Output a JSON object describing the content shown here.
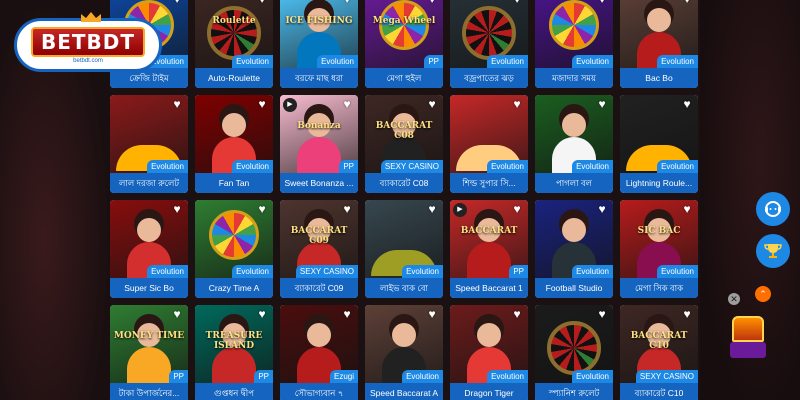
{
  "logo": {
    "text": "BETBDT",
    "sub": "betbdt.com"
  },
  "colors": {
    "accent": "#1565c0",
    "tag": "#1e88e5",
    "background": "#1b1112"
  },
  "games": [
    {
      "name": "ক্রেজি টাইম",
      "provider": "Evolution",
      "art": "wheel",
      "bg": "#0d47a1",
      "body": "#c2185b"
    },
    {
      "name": "Auto-Roulette",
      "provider": "Evolution",
      "art": "roulette",
      "bg": "#3e2723",
      "label": "Roulette"
    },
    {
      "name": "বরফে মাছ ধরা",
      "provider": "Evolution",
      "art": "person",
      "bg": "#4fc3f7",
      "body": "#0277bd",
      "label": "ICE FISHING"
    },
    {
      "name": "মেগা হুইল",
      "provider": "PP",
      "art": "wheel",
      "bg": "#6a1b9a",
      "label": "Mega Wheel"
    },
    {
      "name": "বজ্রপাতের ঝড়",
      "provider": "Evolution",
      "art": "roulette",
      "bg": "#263238"
    },
    {
      "name": "মজাদার সময়",
      "provider": "Evolution",
      "art": "wheel",
      "bg": "#4a148c"
    },
    {
      "name": "Bac Bo",
      "provider": "Evolution",
      "art": "person",
      "bg": "#5d4037",
      "body": "#b71c1c"
    },
    {
      "name": "লাল দরজা রুলেট",
      "provider": "Evolution",
      "art": "table",
      "bg": "#8b1a1a",
      "body": "#ffb300"
    },
    {
      "name": "Fan Tan",
      "provider": "Evolution",
      "art": "person",
      "bg": "#7f0000",
      "body": "#e53935"
    },
    {
      "name": "Sweet Bonanza ...",
      "provider": "PP",
      "art": "person",
      "bg": "#f8bbd0",
      "body": "#ec407a",
      "label": "Bonanza",
      "play": true
    },
    {
      "name": "ব্যাকারেট C08",
      "provider": "SEXY CASINO",
      "art": "person",
      "bg": "#3e2723",
      "body": "#212121",
      "label": "BACCARAT C08"
    },
    {
      "name": "শিল্ড সুপার সি...",
      "provider": "Evolution",
      "art": "table",
      "bg": "#c62828",
      "body": "#ffcc80"
    },
    {
      "name": "পাগলা বল",
      "provider": "Evolution",
      "art": "person",
      "bg": "#1b5e20",
      "body": "#f5f5f5"
    },
    {
      "name": "Lightning Roule...",
      "provider": "Evolution",
      "art": "table",
      "bg": "#212121",
      "body": "#ffb300"
    },
    {
      "name": "Super Sic Bo",
      "provider": "Evolution",
      "art": "person",
      "bg": "#880e0e",
      "body": "#d32f2f"
    },
    {
      "name": "Crazy Time A",
      "provider": "Evolution",
      "art": "wheel",
      "bg": "#2e7d32"
    },
    {
      "name": "ব্যাকারেট C09",
      "provider": "SEXY CASINO",
      "art": "person",
      "bg": "#4e342e",
      "body": "#c62828",
      "label": "BACCARAT C09"
    },
    {
      "name": "লাইভ বাক বো",
      "provider": "Evolution",
      "art": "table",
      "bg": "#37474f",
      "body": "#9e9d24"
    },
    {
      "name": "Speed Baccarat 1",
      "provider": "PP",
      "art": "person",
      "bg": "#c62828",
      "body": "#b71c1c",
      "label": "BACCARAT",
      "play": true
    },
    {
      "name": "Football Studio",
      "provider": "Evolution",
      "art": "person",
      "bg": "#1a237e",
      "body": "#263238"
    },
    {
      "name": "মেগা সিক বাক",
      "provider": "Evolution",
      "art": "person",
      "bg": "#b71c1c",
      "body": "#880e4f",
      "label": "SIC BAC"
    },
    {
      "name": "টাকা উপার্জনের...",
      "provider": "PP",
      "art": "person",
      "bg": "#2e7d32",
      "body": "#f9a825",
      "label": "MONEY TIME"
    },
    {
      "name": "গুপ্তধন দ্বীপ",
      "provider": "PP",
      "art": "person",
      "bg": "#00695c",
      "body": "#c62828",
      "label": "TREASURE ISLAND"
    },
    {
      "name": "সৌভাগ্যবান ৭",
      "provider": "Ezugi",
      "art": "person",
      "bg": "#4a0e0e",
      "body": "#b71c1c"
    },
    {
      "name": "Speed Baccarat A",
      "provider": "Evolution",
      "art": "person",
      "bg": "#5d4037",
      "body": "#212121"
    },
    {
      "name": "Dragon Tiger",
      "provider": "Evolution",
      "art": "person",
      "bg": "#6d1b1b",
      "body": "#e53935"
    },
    {
      "name": "স্প্যানিশ রুলেট",
      "provider": "Evolution",
      "art": "roulette",
      "bg": "#1b1b1b"
    },
    {
      "name": "ব্যাকারেট C10",
      "provider": "SEXY CASINO",
      "art": "person",
      "bg": "#3e2723",
      "body": "#c62828",
      "label": "BACCARAT C10"
    }
  ],
  "side": {
    "support_icon": "chat-support-icon",
    "trophy_icon": "trophy-icon",
    "close_glyph": "✕",
    "up_glyph": "⌃"
  }
}
